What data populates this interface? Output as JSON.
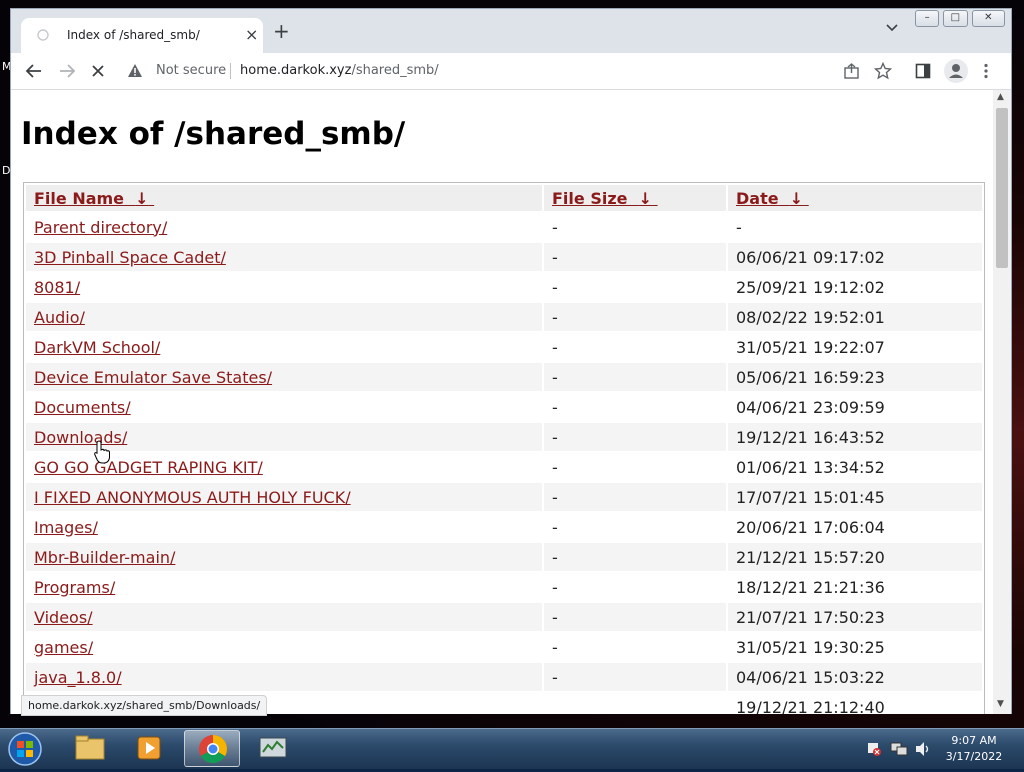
{
  "desktop": {
    "left_letters": [
      "M",
      "D"
    ]
  },
  "browser": {
    "tab_title": "Index of /shared_smb/",
    "new_tab_symbol": "+",
    "tab_close_symbol": "×",
    "security_label": "Not secure",
    "url_host": "home.darkok.xyz",
    "url_path": "/shared_smb/"
  },
  "page": {
    "heading": "Index of /shared_smb/",
    "columns": [
      {
        "label": "File Name",
        "sort": "↓"
      },
      {
        "label": "File Size",
        "sort": "↓"
      },
      {
        "label": "Date",
        "sort": "↓"
      }
    ],
    "rows": [
      {
        "name": "Parent directory/",
        "size": "-",
        "date": "-"
      },
      {
        "name": "3D Pinball Space Cadet/",
        "size": "-",
        "date": "06/06/21 09:17:02"
      },
      {
        "name": "8081/",
        "size": "-",
        "date": "25/09/21 19:12:02"
      },
      {
        "name": "Audio/",
        "size": "-",
        "date": "08/02/22 19:52:01"
      },
      {
        "name": "DarkVM School/",
        "size": "-",
        "date": "31/05/21 19:22:07"
      },
      {
        "name": "Device Emulator Save States/",
        "size": "-",
        "date": "05/06/21 16:59:23"
      },
      {
        "name": "Documents/",
        "size": "-",
        "date": "04/06/21 23:09:59"
      },
      {
        "name": "Downloads/",
        "size": "-",
        "date": "19/12/21 16:43:52"
      },
      {
        "name": "GO GO GADGET RAPING KIT/",
        "size": "-",
        "date": "01/06/21 13:34:52"
      },
      {
        "name": "I FIXED ANONYMOUS AUTH HOLY FUCK/",
        "size": "-",
        "date": "17/07/21 15:01:45"
      },
      {
        "name": "Images/",
        "size": "-",
        "date": "20/06/21 17:06:04"
      },
      {
        "name": "Mbr-Builder-main/",
        "size": "-",
        "date": "21/12/21 15:57:20"
      },
      {
        "name": "Programs/",
        "size": "-",
        "date": "18/12/21 21:21:36"
      },
      {
        "name": "Videos/",
        "size": "-",
        "date": "21/07/21 17:50:23"
      },
      {
        "name": "games/",
        "size": "-",
        "date": "31/05/21 19:30:25"
      },
      {
        "name": "java_1.8.0/",
        "size": "-",
        "date": "04/06/21 15:03:22"
      },
      {
        "name": "",
        "size": "",
        "date": "19/12/21 21:12:40"
      }
    ],
    "status_url": "home.darkok.xyz/shared_smb/Downloads/"
  },
  "taskbar": {
    "time": "9:07 AM",
    "date": "3/17/2022",
    "items": [
      "explorer",
      "media-player",
      "chrome",
      "task-manager"
    ]
  },
  "colors": {
    "link": "#8b1a1a",
    "header_bg": "#eeeeee",
    "row_alt": "#f4f4f4"
  }
}
